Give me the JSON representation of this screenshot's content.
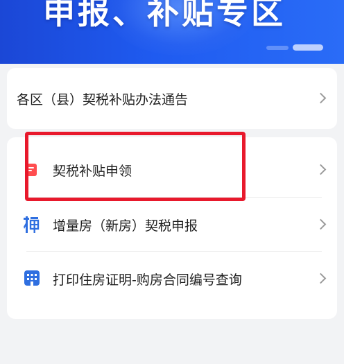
{
  "banner": {
    "title": "申报、补贴专区"
  },
  "card1": {
    "items": [
      {
        "label": "各区（县）契税补贴办法通告"
      }
    ]
  },
  "card2": {
    "items": [
      {
        "label": "契税补贴申领",
        "icon": "document-icon",
        "icon_color": "#ff4d4f"
      },
      {
        "label": "增量房（新房）契税申报",
        "icon": "tax-icon",
        "icon_color": "#2f6fe0"
      },
      {
        "label": "打印住房证明-购房合同编号查询",
        "icon": "building-icon",
        "icon_color": "#2f6fe0"
      }
    ]
  },
  "colors": {
    "banner": "#1f5bf0",
    "highlight": "#e8192c"
  }
}
